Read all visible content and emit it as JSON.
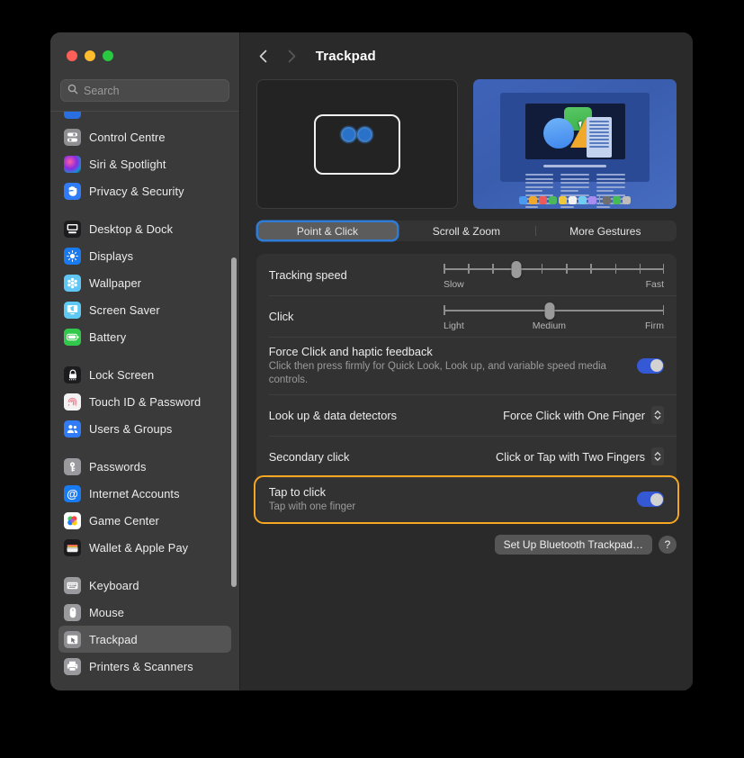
{
  "window": {
    "traffic_lights": [
      {
        "name": "close-button",
        "color": "#ff5f57"
      },
      {
        "name": "minimize-button",
        "color": "#febc2e"
      },
      {
        "name": "maximize-button",
        "color": "#28c840"
      }
    ]
  },
  "search": {
    "placeholder": "Search",
    "value": ""
  },
  "sidebar": {
    "items": [
      {
        "label": "",
        "icon": "partial-blue-icon",
        "icon_bg": "#2a6fe0",
        "glyph": "",
        "partial": true
      },
      {
        "label": "Control Centre",
        "icon": "control-centre-icon",
        "icon_bg": "#8e8e93",
        "glyph": ""
      },
      {
        "label": "Siri & Spotlight",
        "icon": "siri-icon",
        "icon_bg": "#1d1d3a",
        "glyph": ""
      },
      {
        "label": "Privacy & Security",
        "icon": "privacy-security-icon",
        "icon_bg": "#2f7cf6",
        "glyph": "✋"
      },
      {
        "gap": true
      },
      {
        "label": "Desktop & Dock",
        "icon": "desktop-dock-icon",
        "icon_bg": "#1c1c1e",
        "glyph": ""
      },
      {
        "label": "Displays",
        "icon": "displays-icon",
        "icon_bg": "#1a7af0",
        "glyph": "☀"
      },
      {
        "label": "Wallpaper",
        "icon": "wallpaper-icon",
        "icon_bg": "#5fc6f5",
        "glyph": "❋"
      },
      {
        "label": "Screen Saver",
        "icon": "screen-saver-icon",
        "icon_bg": "#5ec9f3",
        "glyph": ""
      },
      {
        "label": "Battery",
        "icon": "battery-icon",
        "icon_bg": "#32c84b",
        "glyph": ""
      },
      {
        "gap": true
      },
      {
        "label": "Lock Screen",
        "icon": "lock-screen-icon",
        "icon_bg": "#1c1c1e",
        "glyph": "🔒"
      },
      {
        "label": "Touch ID & Password",
        "icon": "touch-id-icon",
        "icon_bg": "#f2f2f2",
        "glyph": ""
      },
      {
        "label": "Users & Groups",
        "icon": "users-groups-icon",
        "icon_bg": "#2f7cf6",
        "glyph": ""
      },
      {
        "gap": true
      },
      {
        "label": "Passwords",
        "icon": "passwords-icon",
        "icon_bg": "#9a9a9e",
        "glyph": ""
      },
      {
        "label": "Internet Accounts",
        "icon": "internet-accounts-icon",
        "icon_bg": "#1a7af0",
        "glyph": "@"
      },
      {
        "label": "Game Center",
        "icon": "game-center-icon",
        "icon_bg": "#ffffff",
        "glyph": ""
      },
      {
        "label": "Wallet & Apple Pay",
        "icon": "wallet-apple-pay-icon",
        "icon_bg": "#1c1c1e",
        "glyph": ""
      },
      {
        "gap": true
      },
      {
        "label": "Keyboard",
        "icon": "keyboard-icon",
        "icon_bg": "#9a9a9e",
        "glyph": ""
      },
      {
        "label": "Mouse",
        "icon": "mouse-icon",
        "icon_bg": "#9a9a9e",
        "glyph": ""
      },
      {
        "label": "Trackpad",
        "icon": "trackpad-icon",
        "icon_bg": "#8e8e93",
        "glyph": "",
        "selected": true
      },
      {
        "label": "Printers & Scanners",
        "icon": "printers-scanners-icon",
        "icon_bg": "#9a9a9e",
        "glyph": ""
      }
    ]
  },
  "toolbar": {
    "back_label": "‹",
    "forward_label": "›",
    "title": "Trackpad"
  },
  "tabs": [
    {
      "label": "Point & Click",
      "active": true
    },
    {
      "label": "Scroll & Zoom",
      "active": false
    },
    {
      "label": "More Gestures",
      "active": false
    }
  ],
  "settings": {
    "tracking_speed": {
      "label": "Tracking speed",
      "min_label": "Slow",
      "max_label": "Fast",
      "value_percent": 33,
      "ticks": 10
    },
    "click": {
      "label": "Click",
      "min_label": "Light",
      "mid_label": "Medium",
      "max_label": "Firm",
      "value_percent": 48,
      "ticks": 0
    },
    "force_click": {
      "label": "Force Click and haptic feedback",
      "description": "Click then press firmly for Quick Look, Look up, and variable speed media controls.",
      "toggle_on": true
    },
    "look_up": {
      "label": "Look up & data detectors",
      "value": "Force Click with One Finger"
    },
    "secondary_click": {
      "label": "Secondary click",
      "value": "Click or Tap with Two Fingers"
    },
    "tap_to_click": {
      "label": "Tap to click",
      "description": "Tap with one finger",
      "toggle_on": true,
      "highlighted": true,
      "highlight_color": "#f5a623"
    }
  },
  "bottom": {
    "setup_button": "Set Up Bluetooth Trackpad…",
    "help_button": "?"
  },
  "preview": {
    "gesture_fingers": 2,
    "dock_colors": [
      "#4a9bf0",
      "#f0a92c",
      "#ec5a5a",
      "#4cb85c",
      "#f0c83c",
      "#f2f2f2",
      "#6fcdf2",
      "#a98cf0",
      "SEP",
      "#6e6e6e",
      "#45bc55",
      "#bdbdbd"
    ]
  },
  "colors": {
    "accent": "#3558d4",
    "tab_focus": "#2f7cd6",
    "highlight": "#f5a623",
    "window_bg": "#2a2a2a",
    "sidebar_bg": "#3a3a3a"
  }
}
